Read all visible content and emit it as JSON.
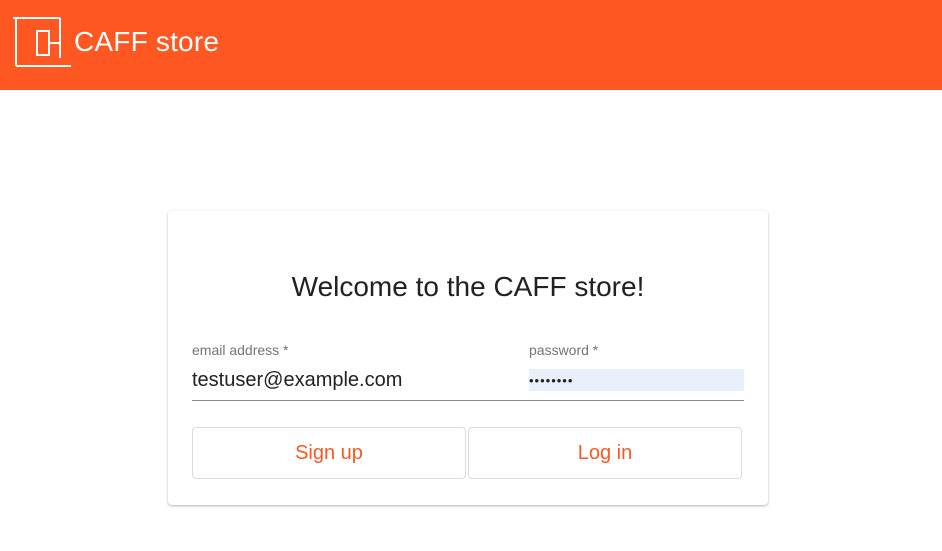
{
  "appbar": {
    "title": "CAFF store",
    "logo_icon": "caff-logo-icon",
    "color": "#ff5722"
  },
  "login": {
    "heading": "Welcome to the CAFF store!",
    "email": {
      "label": "email address *",
      "value": "testuser@example.com"
    },
    "password": {
      "label": "password *",
      "value": "••••••••"
    },
    "signup_label": "Sign up",
    "login_label": "Log in"
  }
}
